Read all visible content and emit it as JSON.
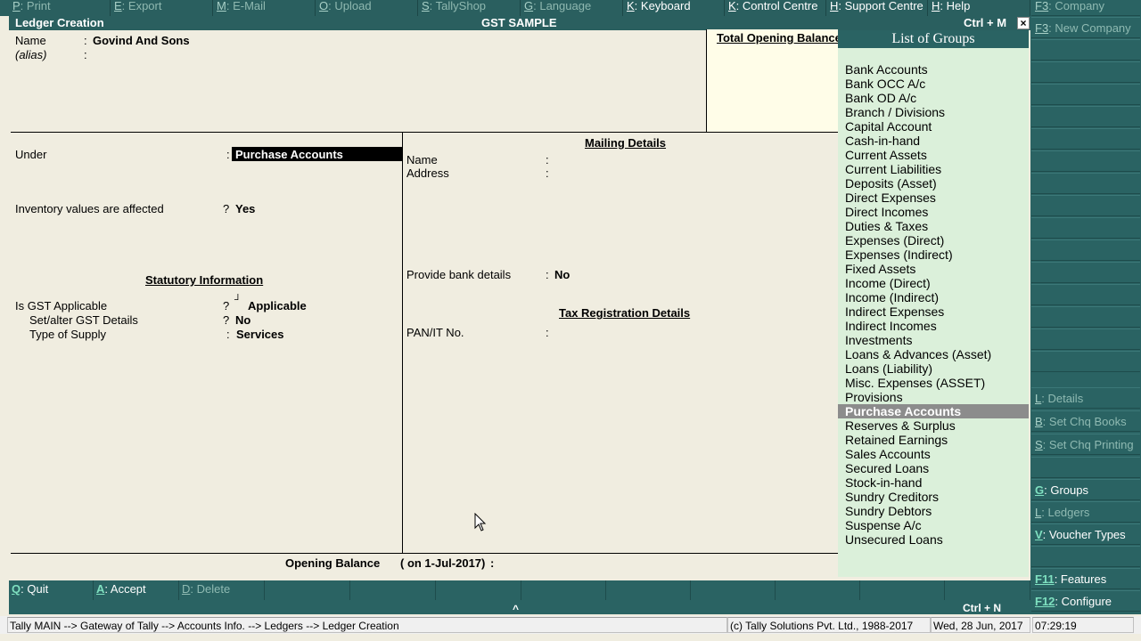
{
  "top_menu": [
    {
      "key": "P",
      "label": ": Print"
    },
    {
      "key": "E",
      "label": ": Export"
    },
    {
      "key": "M",
      "label": ": E-Mail"
    },
    {
      "key": "O",
      "label": ": Upload"
    },
    {
      "key": "S",
      "label": ": TallyShop"
    },
    {
      "key": "G",
      "label": ": Language"
    },
    {
      "key": "K",
      "label": ": Keyboard"
    },
    {
      "key": "K",
      "label": ": Control Centre"
    },
    {
      "key": "H",
      "label": ": Support Centre"
    },
    {
      "key": "H",
      "label": ": Help"
    }
  ],
  "right_panel": [
    {
      "key": "F3",
      "label": ": Company"
    },
    {
      "key": "F3",
      "label": ": New Company"
    },
    {
      "key": "L",
      "label": ": Details"
    },
    {
      "key": "B",
      "label": ": Set Chq Books"
    },
    {
      "key": "S",
      "label": ": Set Chq Printing"
    },
    {
      "key": "G",
      "label": ": Groups"
    },
    {
      "key": "L",
      "label": ": Ledgers"
    },
    {
      "key": "V",
      "label": ": Voucher Types"
    },
    {
      "key": "F11",
      "label": ": Features"
    },
    {
      "key": "F12",
      "label": ": Configure"
    }
  ],
  "title_bar": {
    "screen": "Ledger Creation",
    "company": "GST SAMPLE",
    "shortcut": "Ctrl + M",
    "close": "×"
  },
  "form": {
    "name_label": "Name",
    "name_value": "Govind And Sons",
    "alias_label": "(alias)",
    "colon": ":",
    "question": "?",
    "under_label": "Under",
    "under_value": "Purchase Accounts",
    "inventory_label": "Inventory values are affected",
    "inventory_value": "Yes",
    "statutory_heading": "Statutory Information",
    "gst_applicable_label": "Is GST Applicable",
    "gst_applicable_value": "Applicable",
    "gst_mark": "┘",
    "gst_details_label": "Set/alter GST Details",
    "gst_details_value": "No",
    "supply_label": "Type of Supply",
    "supply_value": "Services",
    "mailing_heading": "Mailing Details",
    "mail_name_label": "Name",
    "mail_address_label": "Address",
    "bank_label": "Provide bank details",
    "bank_value": "No",
    "tax_heading": "Tax Registration Details",
    "pan_label": "PAN/IT No.",
    "opening_label": "Opening Balance",
    "opening_date": "( on 1-Jul-2017)",
    "total_opening": "Total Opening Balance"
  },
  "group_list": {
    "title": "List of Groups",
    "selected": "Purchase Accounts",
    "items": [
      "Bank Accounts",
      "Bank OCC A/c",
      "Bank OD A/c",
      "Branch / Divisions",
      "Capital Account",
      "Cash-in-hand",
      "Current Assets",
      "Current Liabilities",
      "Deposits (Asset)",
      "Direct Expenses",
      "Direct Incomes",
      "Duties & Taxes",
      "Expenses (Direct)",
      "Expenses (Indirect)",
      "Fixed Assets",
      "Income (Direct)",
      "Income (Indirect)",
      "Indirect Expenses",
      "Indirect Incomes",
      "Investments",
      "Loans & Advances (Asset)",
      "Loans (Liability)",
      "Misc. Expenses (ASSET)",
      "Provisions",
      "Purchase Accounts",
      "Reserves & Surplus",
      "Retained Earnings",
      "Sales Accounts",
      "Secured Loans",
      "Stock-in-hand",
      "Sundry Creditors",
      "Sundry Debtors",
      "Suspense A/c",
      "Unsecured Loans"
    ]
  },
  "bottom_bar": [
    {
      "key": "Q",
      "label": ": Quit"
    },
    {
      "key": "A",
      "label": ": Accept"
    },
    {
      "key": "D",
      "label": ": Delete"
    }
  ],
  "info_bar": {
    "arrow": "^",
    "shortcut": "Ctrl + N"
  },
  "status_bar": {
    "breadcrumb": "Tally MAIN --> Gateway of Tally --> Accounts Info. --> Ledgers --> Ledger Creation",
    "copyright": "(c) Tally Solutions Pvt. Ltd., 1988-2017",
    "date": "Wed, 28 Jun, 2017",
    "time": "07:29:19"
  }
}
